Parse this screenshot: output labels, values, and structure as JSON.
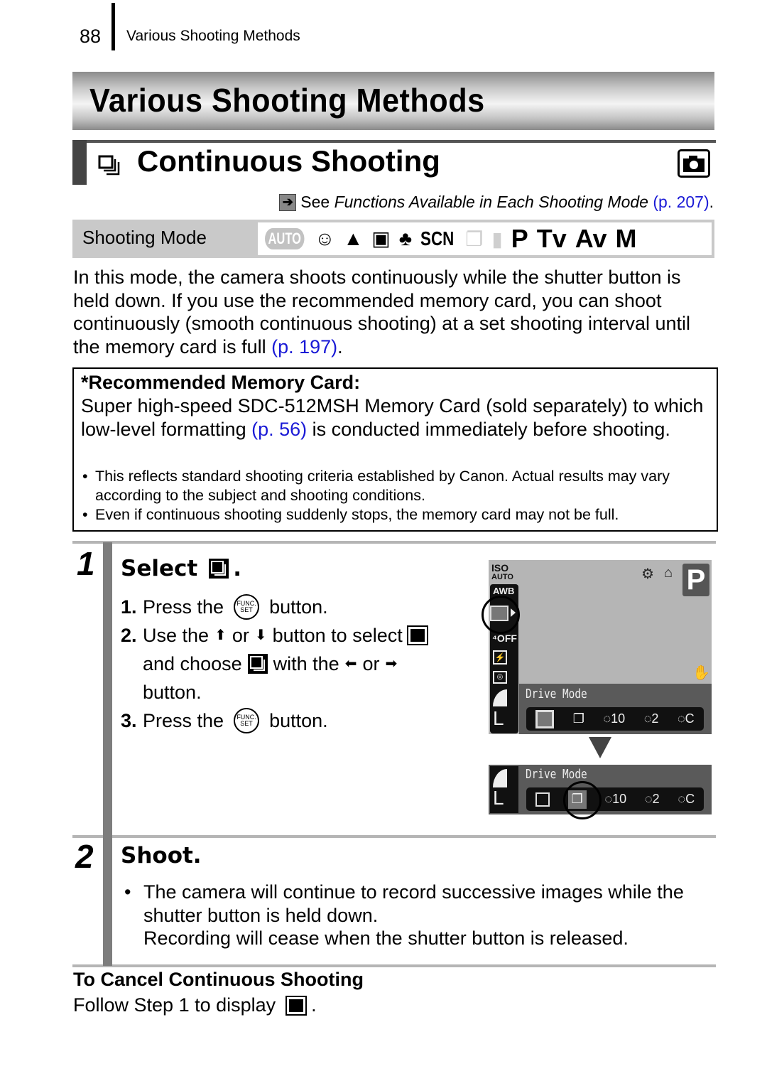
{
  "header": {
    "page_number": "88",
    "running_title": "Various Shooting Methods"
  },
  "chapter": {
    "title": "Various Shooting Methods"
  },
  "section": {
    "icon": "continuous-shooting-icon",
    "title": "Continuous Shooting",
    "mode_icon": "camera-icon",
    "see_ref": {
      "prefix": "See",
      "italic": "Functions Available in Each Shooting Mode",
      "link": "(p. 207)",
      "suffix": "."
    }
  },
  "shooting_mode": {
    "label": "Shooting Mode",
    "modes": [
      {
        "name": "AUTO",
        "available": false
      },
      {
        "name": "portrait",
        "glyph": "☺",
        "available": true
      },
      {
        "name": "landscape",
        "glyph": "▲",
        "available": true
      },
      {
        "name": "night-scene",
        "glyph": "▣",
        "available": true
      },
      {
        "name": "kids-pets",
        "glyph": "♣",
        "available": true
      },
      {
        "name": "SCN",
        "available": true
      },
      {
        "name": "stitch-assist",
        "glyph": "❐",
        "available": false
      },
      {
        "name": "movie",
        "glyph": "▮",
        "available": false
      },
      {
        "name": "P",
        "available": true
      },
      {
        "name": "Tv",
        "available": true
      },
      {
        "name": "Av",
        "available": true
      },
      {
        "name": "M",
        "available": true
      }
    ]
  },
  "intro": {
    "text": "In this mode, the camera shoots continuously while the shutter button is held down. If you use the recommended memory card, you can shoot continuously (smooth continuous shooting) at a set shooting interval until the memory card is full ",
    "link": "(p. 197)",
    "suffix": "."
  },
  "note": {
    "heading": "*Recommended Memory Card:",
    "body_before": "Super high-speed SDC-512MSH Memory Card (sold separately) to which low-level formatting ",
    "body_link": "(p. 56)",
    "body_after": " is conducted immediately before shooting.",
    "bullets": [
      "This reflects standard shooting criteria established by Canon. Actual results may vary according to the subject and shooting conditions.",
      "Even if continuous shooting suddenly stops, the memory card may not be full."
    ]
  },
  "steps": [
    {
      "number": "1",
      "title": "Select",
      "title_suffix": ".",
      "substeps": {
        "s1_num": "1.",
        "s1_a": "Press the",
        "s1_b": "button.",
        "s2_num": "2.",
        "s2_a": "Use the",
        "s2_or1": "or",
        "s2_b": "button to select",
        "s2_c": "and choose",
        "s2_d": "with the",
        "s2_or2": "or",
        "s2_e": "button.",
        "s3_num": "3.",
        "s3_a": "Press the",
        "s3_b": "button.",
        "func_label_top": "FUNC.",
        "func_label_bottom": "SET"
      },
      "lcd": {
        "iso_top": "ISO",
        "iso_bottom": "AUTO",
        "wb": "AWB",
        "flash_off": "⁴OFF",
        "mode": "P",
        "menu_title": "Drive Mode",
        "drive_options": [
          "single",
          "continuous",
          "self-timer-10s",
          "self-timer-2s",
          "custom-timer"
        ],
        "drive_labels": [
          "□",
          "❐",
          "◌10",
          "◌2",
          "◌C"
        ],
        "selected_before": "single",
        "selected_after": "continuous",
        "size": "L"
      }
    },
    {
      "number": "2",
      "title": "Shoot.",
      "bullet": "The camera will continue to record successive images while the shutter button is held down.",
      "extra": "Recording will cease when the shutter button is released."
    }
  ],
  "cancel": {
    "heading": "To Cancel Continuous Shooting",
    "text": "Follow Step 1 to display",
    "suffix": "."
  }
}
